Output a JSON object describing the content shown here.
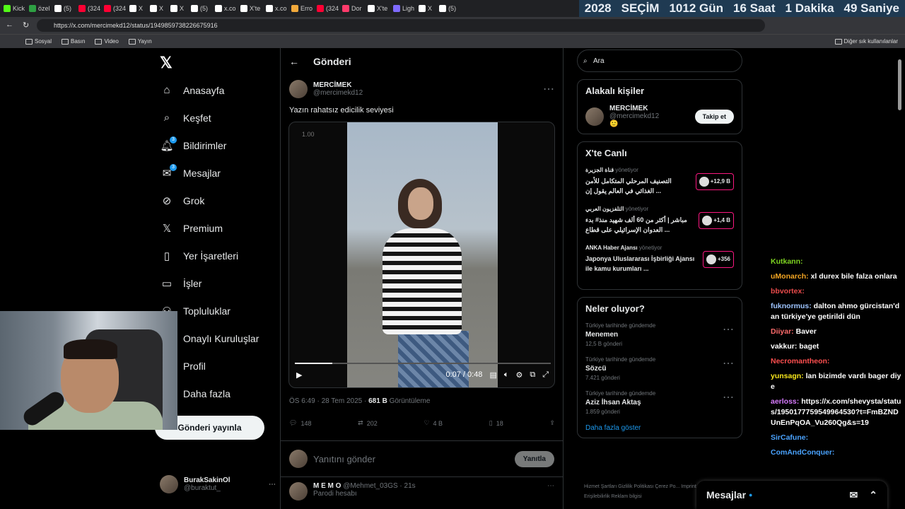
{
  "browser": {
    "tabs": [
      "Kick",
      "özel",
      "(5)",
      "(324",
      "(324",
      "X",
      "X",
      "X",
      "(5)",
      "x.co",
      "X'te",
      "x.co",
      "Erro",
      "(324",
      "Dor",
      "X'te",
      "Ligh",
      "X",
      "(5)"
    ],
    "countdown": {
      "year": "2028",
      "label": "SEÇİM",
      "days": "1012 Gün",
      "hours": "16 Saat",
      "minutes": "1 Dakika",
      "seconds": "49 Saniye"
    },
    "url": "https://x.com/mercimekd12/status/1949859738226675916",
    "bookmarks": [
      "Sosyal",
      "Basın",
      "Video",
      "Yayın"
    ],
    "bookmarks_other": "Diğer sık kullanılanlar"
  },
  "nav": {
    "items": [
      {
        "label": "Anasayfa",
        "icon": "⌂"
      },
      {
        "label": "Keşfet",
        "icon": "⌕"
      },
      {
        "label": "Bildirimler",
        "icon": "🔔︎",
        "badge": "3"
      },
      {
        "label": "Mesajlar",
        "icon": "✉",
        "badge": "3"
      },
      {
        "label": "Grok",
        "icon": "⊘"
      },
      {
        "label": "Premium",
        "icon": "𝕏"
      },
      {
        "label": "Yer İşaretleri",
        "icon": "▯"
      },
      {
        "label": "İşler",
        "icon": "▭"
      },
      {
        "label": "Topluluklar",
        "icon": "⚇"
      },
      {
        "label": "Onaylı Kuruluşlar",
        "icon": "✓"
      },
      {
        "label": "Profil",
        "icon": "☺"
      },
      {
        "label": "Daha fazla",
        "icon": "⋯"
      }
    ],
    "post_button": "Gönderi yayınla",
    "account": {
      "name": "BurakSakinOl",
      "handle": "@buraktut_"
    }
  },
  "main": {
    "title": "Gönderi",
    "author": {
      "name": "MERCİMEK",
      "handle": "@mercimekd12"
    },
    "text": "Yazın rahatsız edicilik seviyesi",
    "video": {
      "speed": "1.00",
      "time": "0:07 / 0:48",
      "progress": 0.146
    },
    "meta": {
      "time": "ÖS 6:49 · 28 Tem 2025 · ",
      "views": "681 B",
      "views_label": " Görüntüleme"
    },
    "actions": {
      "replies": "148",
      "reposts": "202",
      "likes": "4 B",
      "bookmarks": "18"
    },
    "reply_placeholder": "Yanıtını gönder",
    "reply_button": "Yanıtla",
    "reply": {
      "name": "M E M O",
      "handle": "@Mehmet_03GS · 21s",
      "sub": "Parodi hesabı"
    }
  },
  "right": {
    "search_placeholder": "Ara",
    "related": {
      "title": "Alakalı kişiler",
      "name": "MERCİMEK",
      "handle": "@mercimekd12",
      "emoji": "🙂",
      "follow": "Takip et"
    },
    "live": {
      "title": "X'te Canlı",
      "items": [
        {
          "source": "قناة الجزيرة",
          "role": "yönetiyor",
          "title": "التصنيف المرحلي المتكامل للأمن الغذائي في العالم يقول إن ...",
          "count": "+12,9 B"
        },
        {
          "source": "التلفزيون العربي",
          "role": "yönetiyor",
          "title": "مباشر | أكثر من 60 ألف شهيد منذ# بدء العدوان الإسرائيلي على قطاع ...",
          "count": "+1,4 B"
        },
        {
          "source": "ANKA Haber Ajansı",
          "role": "yönetiyor",
          "title": "Japonya Uluslararası İşbirliği Ajansı ile kamu kurumları ...",
          "count": "+356"
        }
      ]
    },
    "trends": {
      "title": "Neler oluyor?",
      "items": [
        {
          "context": "Türkiye tarihinde gündemde",
          "name": "Menemen",
          "count": "12,5 B gönderi"
        },
        {
          "context": "Türkiye tarihinde gündemde",
          "name": "Sözcü",
          "count": "7.421 gönderi"
        },
        {
          "context": "Türkiye tarihinde gündemde",
          "name": "Aziz İhsan Aktaş",
          "count": "1.859 gönderi"
        }
      ],
      "more": "Daha fazla göster"
    },
    "footer": "Hizmet Şartları   Gizlilik Politikası   Çerez Po... Imprint   Erişilebilirlik   Reklam bilgisi",
    "messages": "Mesajlar"
  },
  "chat": [
    {
      "user": "Kutkann:",
      "text": "",
      "color": "#7ed321"
    },
    {
      "user": "uMonarch:",
      "text": " xl durex bile falza onlara",
      "color": "#f5a623"
    },
    {
      "user": "bbvortex:",
      "text": "",
      "color": "#e94b4b"
    },
    {
      "user": "fuknormus:",
      "text": " dalton ahmo gürcistan'dan türkiye'ye getirildi dün",
      "color": "#9ec4ff"
    },
    {
      "user": "Diiyar:",
      "text": " Baver",
      "color": "#ff6b6b"
    },
    {
      "user": "vakkur:",
      "text": " baget",
      "color": "#ffffff"
    },
    {
      "user": "Necromantheon:",
      "text": "",
      "color": "#ff4f4f"
    },
    {
      "user": "yunsagn:",
      "text": " lan bizimde vardı bager diye",
      "color": "#f8e71c"
    },
    {
      "user": "aerloss:",
      "text": " https://x.com/shevysta/status/1950177759549964530?t=FmBZNDUnEnPqOA_Vu260Qg&s=19",
      "color": "#d87bff"
    },
    {
      "user": "SirCafune:",
      "text": "",
      "color": "#4aa3ff"
    },
    {
      "user": "ComAndConquer:",
      "text": "",
      "color": "#4aa3ff"
    }
  ]
}
